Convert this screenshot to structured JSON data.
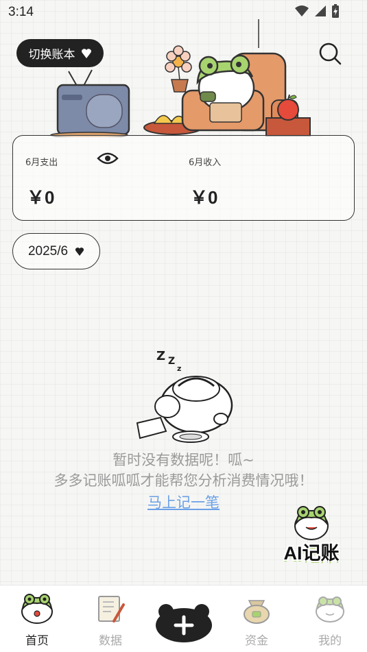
{
  "status_bar": {
    "time": "3:14"
  },
  "header": {
    "switch_account_label": "切换账本"
  },
  "summary": {
    "expense_label": "6月支出",
    "expense_value": "￥0",
    "income_label": "6月收入",
    "income_value": "￥0"
  },
  "month_picker": {
    "value": "2025/6"
  },
  "empty_state": {
    "line1": "暂时没有数据呢！呱~",
    "line2": "多多记账呱呱才能帮您分析消费情况哦！",
    "link": "马上记一笔"
  },
  "ai_button": {
    "label": "AI记账"
  },
  "tabs": [
    {
      "label": "首页",
      "icon": "frog-home-icon",
      "active": true
    },
    {
      "label": "数据",
      "icon": "notebook-icon",
      "active": false
    },
    {
      "label": "资金",
      "icon": "money-bag-icon",
      "active": false
    },
    {
      "label": "我的",
      "icon": "frog-profile-icon",
      "active": false
    }
  ],
  "colors": {
    "dark": "#222222",
    "link": "#6aa0e6",
    "frog_green": "#a8d46f",
    "muted_text": "#9a9a9a"
  }
}
